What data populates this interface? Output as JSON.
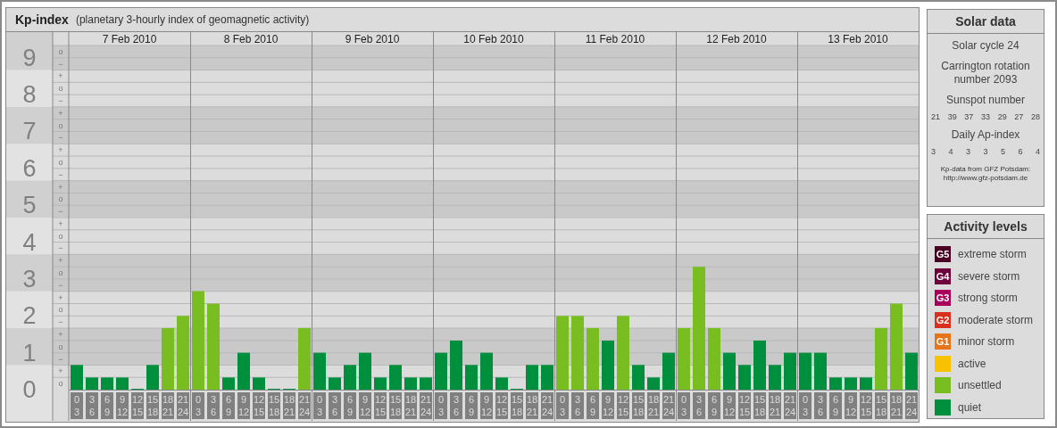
{
  "header": {
    "title": "Kp-index",
    "subtitle": "(planetary 3-hourly index of geomagnetic activity)"
  },
  "kp_chart": {
    "sub_labels": [
      "o",
      "−",
      "+",
      "o",
      "−",
      "+",
      "o",
      "−",
      "+",
      "o",
      "−",
      "+",
      "o",
      "−",
      "+",
      "o",
      "−",
      "+",
      "o",
      "−",
      "+",
      "o",
      "−",
      "+",
      "o",
      "−",
      "+",
      "o"
    ],
    "days": [
      "7 Feb 2010",
      "8 Feb 2010",
      "9 Feb 2010",
      "10 Feb 2010",
      "11 Feb 2010",
      "12 Feb 2010",
      "13 Feb 2010"
    ],
    "chart_data": {
      "type": "bar",
      "ylim": [
        0,
        9.33
      ],
      "yticks": [
        9,
        8,
        7,
        6,
        5,
        4,
        3,
        2,
        1,
        0
      ],
      "grid": true,
      "bands": [
        {
          "axis": "y",
          "from": 8.67,
          "to": 9.33
        },
        {
          "axis": "y",
          "from": 6.67,
          "to": 7.67
        },
        {
          "axis": "y",
          "from": 4.67,
          "to": 5.67
        },
        {
          "axis": "y",
          "from": 2.67,
          "to": 3.67
        },
        {
          "axis": "y",
          "from": 0.67,
          "to": 1.67
        }
      ],
      "categories": [
        "0\n3",
        "3\n6",
        "6\n9",
        "9\n12",
        "12\n15",
        "15\n18",
        "18\n21",
        "21\n24",
        "0\n3",
        "3\n6",
        "6\n9",
        "9\n12",
        "12\n15",
        "15\n18",
        "18\n21",
        "21\n24",
        "0\n3",
        "3\n6",
        "6\n9",
        "9\n12",
        "12\n15",
        "15\n18",
        "18\n21",
        "21\n24",
        "0\n3",
        "3\n6",
        "6\n9",
        "9\n12",
        "12\n15",
        "15\n18",
        "18\n21",
        "21\n24",
        "0\n3",
        "3\n6",
        "6\n9",
        "9\n12",
        "12\n15",
        "15\n18",
        "18\n21",
        "21\n24",
        "0\n3",
        "3\n6",
        "6\n9",
        "9\n12",
        "12\n15",
        "15\n18",
        "18\n21",
        "21\n24",
        "0\n3",
        "3\n6",
        "6\n9",
        "9\n12",
        "12\n15",
        "15\n18",
        "18\n21",
        "21\n24"
      ],
      "series": [
        {
          "name": "quiet",
          "color": "#008f3c",
          "values": [
            0.67,
            0.33,
            0.33,
            0.33,
            0,
            0.67,
            null,
            null,
            null,
            null,
            0.33,
            1,
            0.33,
            0,
            0,
            null,
            1,
            0.33,
            0.67,
            1,
            0.33,
            0.67,
            0.33,
            0.33,
            1,
            1.33,
            0.67,
            1,
            0.33,
            0,
            0.67,
            0.67,
            null,
            null,
            null,
            1.33,
            null,
            0.67,
            0.33,
            1,
            null,
            null,
            null,
            1,
            0.67,
            1.33,
            0.67,
            1,
            1,
            1,
            0.33,
            0.33,
            0.33,
            null,
            null,
            1
          ]
        },
        {
          "name": "unsettled",
          "color": "#78be20",
          "values": [
            null,
            null,
            null,
            null,
            null,
            null,
            1.67,
            2,
            2.67,
            2.33,
            null,
            null,
            null,
            null,
            null,
            1.67,
            null,
            null,
            null,
            null,
            null,
            null,
            null,
            null,
            null,
            null,
            null,
            null,
            null,
            null,
            null,
            null,
            2,
            2,
            1.67,
            null,
            2,
            null,
            null,
            null,
            1.67,
            3.33,
            1.67,
            null,
            null,
            null,
            null,
            null,
            null,
            null,
            null,
            null,
            null,
            1.67,
            2.33,
            null
          ]
        }
      ]
    }
  },
  "solar_data": {
    "title": "Solar data",
    "cycle": "Solar cycle 24",
    "rotation": "Carrington rotation number 2093",
    "sunspot_label": "Sunspot number",
    "sunspots": [
      "21",
      "39",
      "37",
      "33",
      "29",
      "27",
      "28"
    ],
    "ap_label": "Daily Ap-index",
    "ap_values": [
      "3",
      "4",
      "3",
      "3",
      "5",
      "6",
      "4"
    ],
    "source": "Kp-data from GFZ Potsdam:",
    "source_url": "http://www.gfz-potsdam.de"
  },
  "legend": {
    "title": "Activity levels",
    "items": [
      {
        "badge": "G5",
        "label": "extreme storm",
        "color": "#4b0023"
      },
      {
        "badge": "G4",
        "label": "severe storm",
        "color": "#6e003c"
      },
      {
        "badge": "G3",
        "label": "strong storm",
        "color": "#a8005a"
      },
      {
        "badge": "G2",
        "label": "moderate storm",
        "color": "#d8301c"
      },
      {
        "badge": "G1",
        "label": "minor storm",
        "color": "#e8741a"
      },
      {
        "label": "active",
        "color": "#f8c200"
      }
    ]
  }
}
